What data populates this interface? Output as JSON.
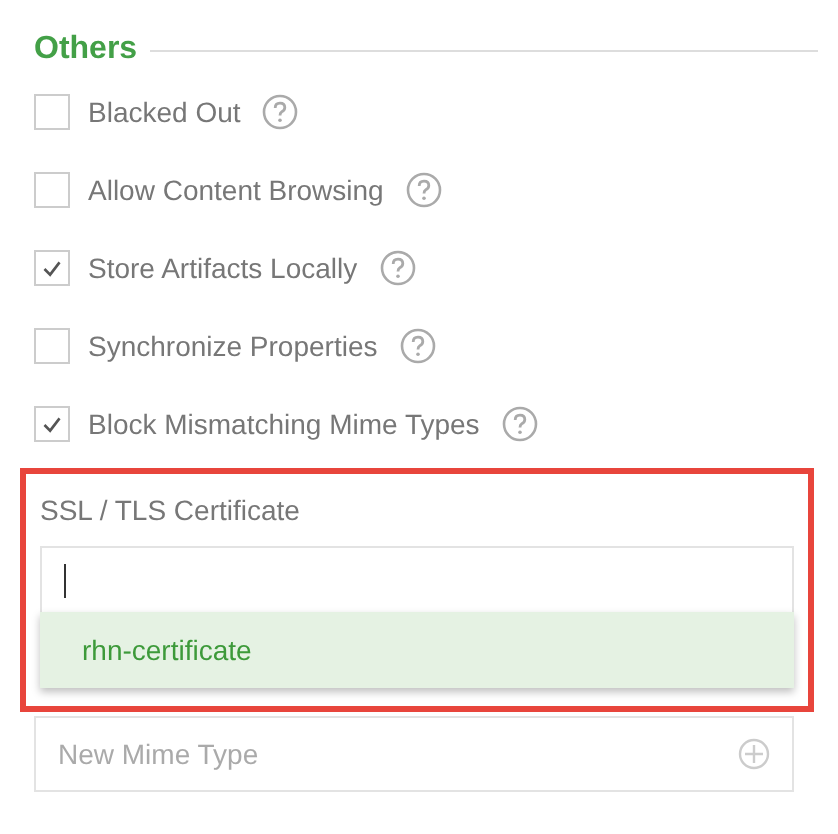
{
  "section": {
    "title": "Others"
  },
  "options": [
    {
      "label": "Blacked Out",
      "checked": false
    },
    {
      "label": "Allow Content Browsing",
      "checked": false
    },
    {
      "label": "Store Artifacts Locally",
      "checked": true
    },
    {
      "label": "Synchronize Properties",
      "checked": false
    },
    {
      "label": "Block Mismatching Mime Types",
      "checked": true
    }
  ],
  "certificate": {
    "label": "SSL / TLS Certificate",
    "focused": true,
    "highlighted": true,
    "suggestions": [
      {
        "label": "rhn-certificate",
        "selected": true
      }
    ]
  },
  "mime_types": {
    "placeholder": "New Mime Type"
  }
}
